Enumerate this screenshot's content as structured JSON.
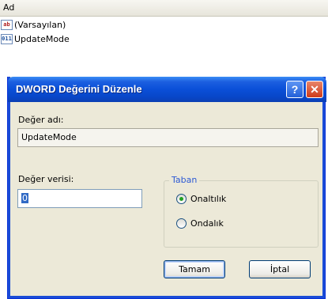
{
  "list": {
    "column_header": "Ad",
    "items": [
      {
        "icon": "string-value-icon",
        "glyph": "ab",
        "label": "(Varsayılan)"
      },
      {
        "icon": "binary-value-icon",
        "glyph": "011",
        "label": "UpdateMode"
      }
    ]
  },
  "dialog": {
    "title": "DWORD Değerini Düzenle",
    "help_glyph": "?",
    "close_glyph": "✕",
    "value_name_label": "Değer adı:",
    "value_name": "UpdateMode",
    "value_data_label": "Değer verisi:",
    "value_data": "0",
    "base_group_label": "Taban",
    "base_options": [
      {
        "label": "Onaltılık",
        "selected": true
      },
      {
        "label": "Ondalık",
        "selected": false
      }
    ],
    "ok_label": "Tamam",
    "cancel_label": "İptal"
  },
  "colors": {
    "titlebar": "#0a4fd8",
    "dialog_bg": "#ece9d8",
    "close": "#cf3b19",
    "group_title": "#2d5ad4"
  }
}
